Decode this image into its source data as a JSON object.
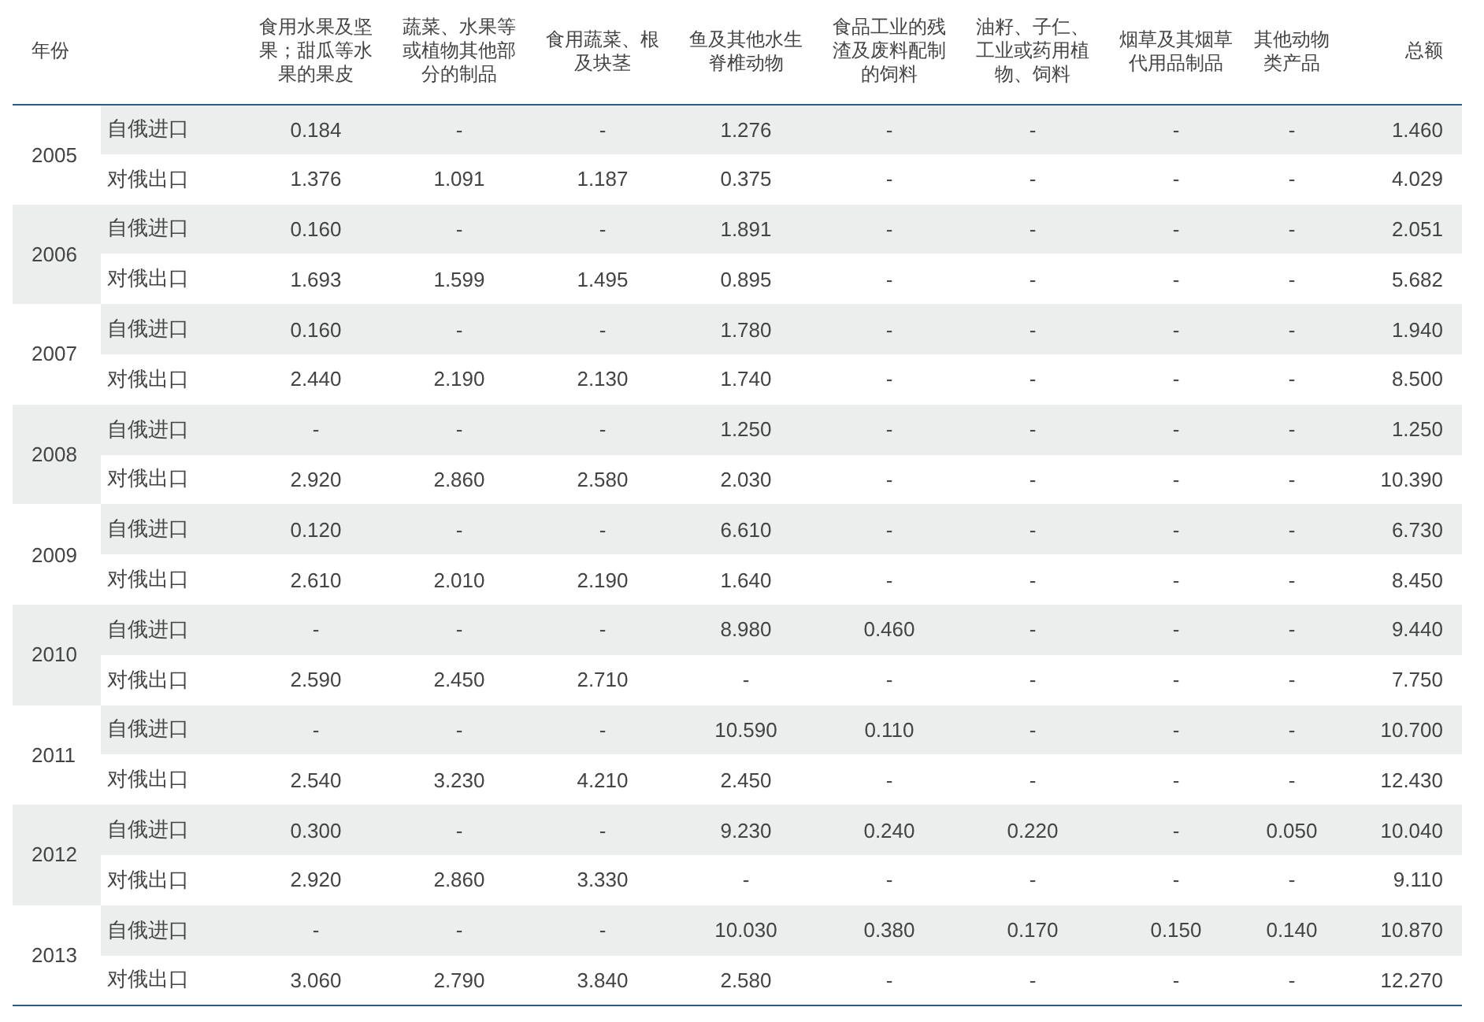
{
  "table": {
    "columns": [
      "年份",
      "食用水果及坚果；甜瓜等水果的果皮",
      "蔬菜、水果等或植物其他部分的制品",
      "食用蔬菜、根及块茎",
      "鱼及其他水生脊椎动物",
      "食品工业的残渣及废料配制的饲料",
      "油籽、子仁、工业或药用植物、饲料",
      "烟草及其烟草代用品制品",
      "其他动物类产品",
      "总额"
    ],
    "groups": [
      {
        "year": "2005",
        "rows": [
          {
            "type": "自俄进口",
            "cells": [
              "0.184",
              "-",
              "-",
              "1.276",
              "-",
              "-",
              "-",
              "-",
              "1.460"
            ]
          },
          {
            "type": "对俄出口",
            "cells": [
              "1.376",
              "1.091",
              "1.187",
              "0.375",
              "-",
              "-",
              "-",
              "-",
              "4.029"
            ]
          }
        ]
      },
      {
        "year": "2006",
        "rows": [
          {
            "type": "自俄进口",
            "cells": [
              "0.160",
              "-",
              "-",
              "1.891",
              "-",
              "-",
              "-",
              "-",
              "2.051"
            ]
          },
          {
            "type": "对俄出口",
            "cells": [
              "1.693",
              "1.599",
              "1.495",
              "0.895",
              "-",
              "-",
              "-",
              "-",
              "5.682"
            ]
          }
        ]
      },
      {
        "year": "2007",
        "rows": [
          {
            "type": "自俄进口",
            "cells": [
              "0.160",
              "-",
              "-",
              "1.780",
              "-",
              "-",
              "-",
              "-",
              "1.940"
            ]
          },
          {
            "type": "对俄出口",
            "cells": [
              "2.440",
              "2.190",
              "2.130",
              "1.740",
              "-",
              "-",
              "-",
              "-",
              "8.500"
            ]
          }
        ]
      },
      {
        "year": "2008",
        "rows": [
          {
            "type": "自俄进口",
            "cells": [
              "-",
              "-",
              "-",
              "1.250",
              "-",
              "-",
              "-",
              "-",
              "1.250"
            ]
          },
          {
            "type": "对俄出口",
            "cells": [
              "2.920",
              "2.860",
              "2.580",
              "2.030",
              "-",
              "-",
              "-",
              "-",
              "10.390"
            ]
          }
        ]
      },
      {
        "year": "2009",
        "rows": [
          {
            "type": "自俄进口",
            "cells": [
              "0.120",
              "-",
              "-",
              "6.610",
              "-",
              "-",
              "-",
              "-",
              "6.730"
            ]
          },
          {
            "type": "对俄出口",
            "cells": [
              "2.610",
              "2.010",
              "2.190",
              "1.640",
              "-",
              "-",
              "-",
              "-",
              "8.450"
            ]
          }
        ]
      },
      {
        "year": "2010",
        "rows": [
          {
            "type": "自俄进口",
            "cells": [
              "-",
              "-",
              "-",
              "8.980",
              "0.460",
              "-",
              "-",
              "-",
              "9.440"
            ]
          },
          {
            "type": "对俄出口",
            "cells": [
              "2.590",
              "2.450",
              "2.710",
              "-",
              "-",
              "-",
              "-",
              "-",
              "7.750"
            ]
          }
        ]
      },
      {
        "year": "2011",
        "rows": [
          {
            "type": "自俄进口",
            "cells": [
              "-",
              "-",
              "-",
              "10.590",
              "0.110",
              "-",
              "-",
              "-",
              "10.700"
            ]
          },
          {
            "type": "对俄出口",
            "cells": [
              "2.540",
              "3.230",
              "4.210",
              "2.450",
              "-",
              "-",
              "-",
              "-",
              "12.430"
            ]
          }
        ]
      },
      {
        "year": "2012",
        "rows": [
          {
            "type": "自俄进口",
            "cells": [
              "0.300",
              "-",
              "-",
              "9.230",
              "0.240",
              "0.220",
              "-",
              "0.050",
              "10.040"
            ]
          },
          {
            "type": "对俄出口",
            "cells": [
              "2.920",
              "2.860",
              "3.330",
              "-",
              "-",
              "-",
              "-",
              "-",
              "9.110"
            ]
          }
        ]
      },
      {
        "year": "2013",
        "rows": [
          {
            "type": "自俄进口",
            "cells": [
              "-",
              "-",
              "-",
              "10.030",
              "0.380",
              "0.170",
              "0.150",
              "0.140",
              "10.870"
            ]
          },
          {
            "type": "对俄出口",
            "cells": [
              "3.060",
              "2.790",
              "3.840",
              "2.580",
              "-",
              "-",
              "-",
              "-",
              "12.270"
            ]
          }
        ]
      }
    ]
  }
}
